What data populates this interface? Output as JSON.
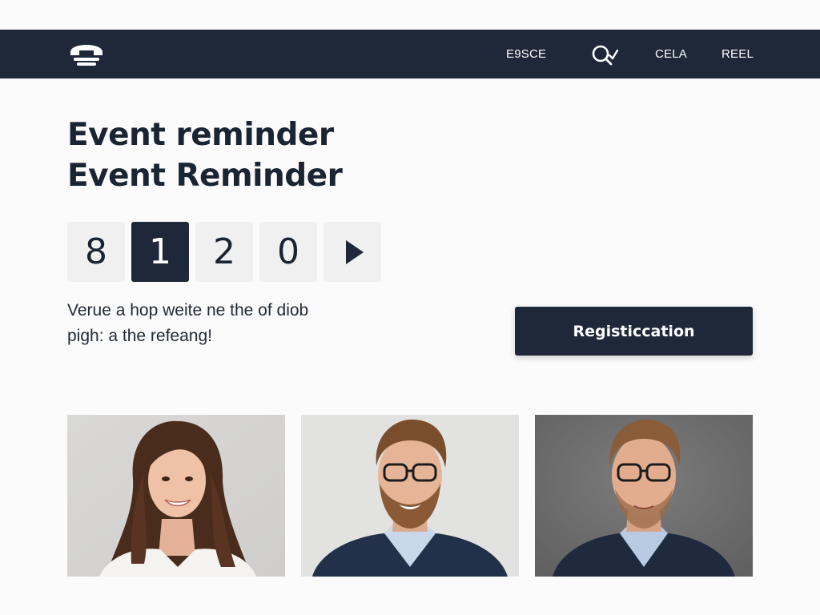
{
  "nav": {
    "logo_icon": "telephone-icon",
    "items": [
      "E9SCE",
      "CELA",
      "REEL"
    ],
    "search_icon": "search-icon"
  },
  "headline": {
    "line1": "Event reminder",
    "line2": "Event Reminder"
  },
  "countdown": {
    "digits": [
      "8",
      "1",
      "2",
      "0"
    ],
    "active_index": 1,
    "next_icon": "play-icon"
  },
  "description": {
    "line1": "Verue  a hop weite ne the of diob",
    "line2": "pigh: a the refeang!"
  },
  "register": {
    "label": "Registiccation"
  },
  "speakers": [
    {
      "kind": "speaker-photo-woman"
    },
    {
      "kind": "speaker-photo-man-glasses"
    },
    {
      "kind": "speaker-photo-man-glasses-dark-bg"
    }
  ],
  "colors": {
    "brand_dark": "#1e2838",
    "page_bg": "#fbfbfb",
    "digit_bg": "#f0f0f0",
    "text": "#1b2433"
  }
}
